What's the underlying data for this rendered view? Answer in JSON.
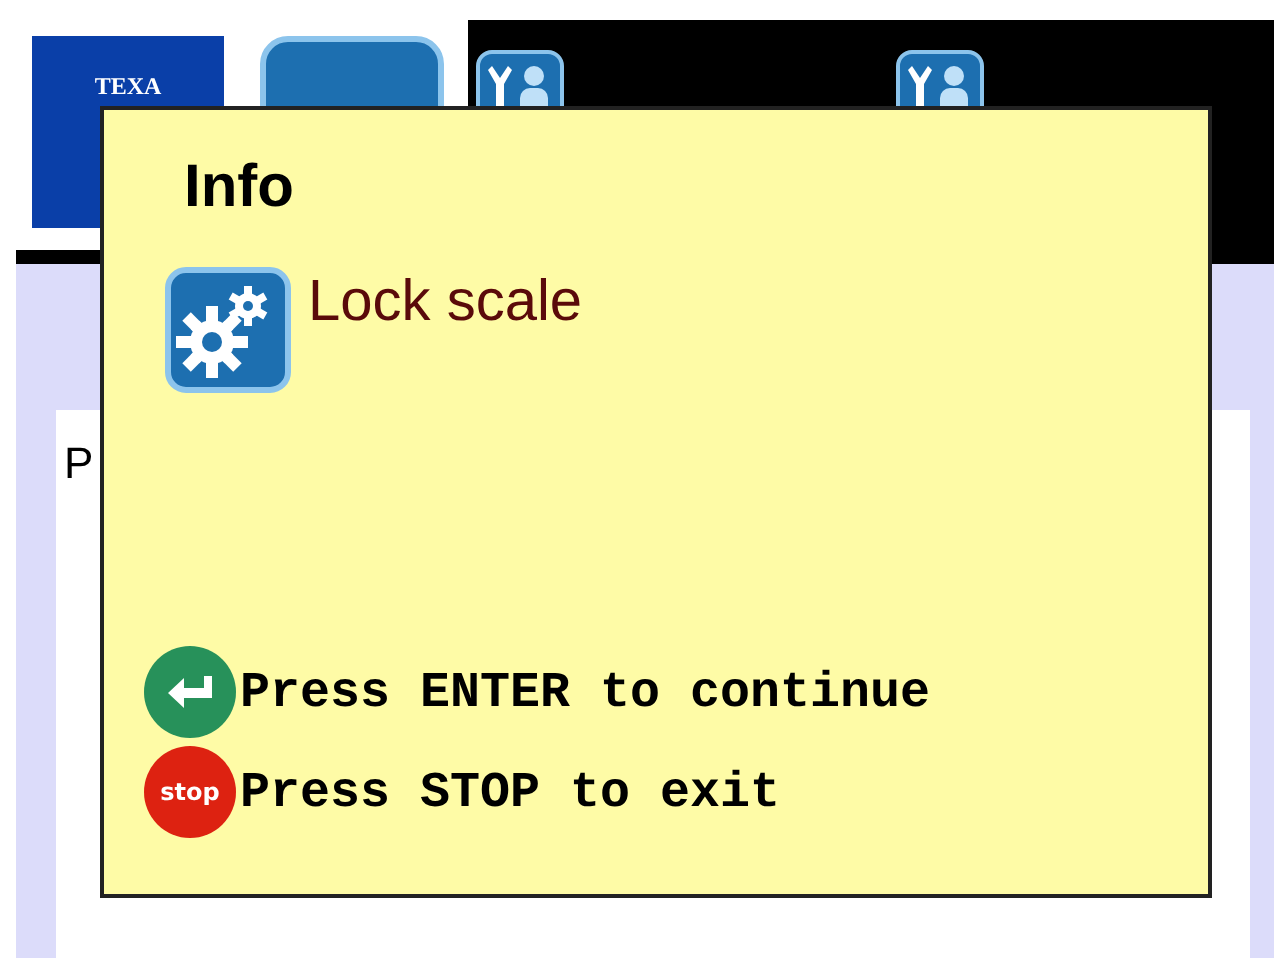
{
  "header": {
    "logo": "TEXA"
  },
  "panel": {
    "title": "P"
  },
  "dialog": {
    "title": "Info",
    "message": "Lock scale",
    "actions": [
      {
        "kind": "enter",
        "label": "Press ENTER to continue"
      },
      {
        "kind": "stop",
        "icon_label": "stop",
        "label": "Press STOP to exit"
      }
    ]
  }
}
